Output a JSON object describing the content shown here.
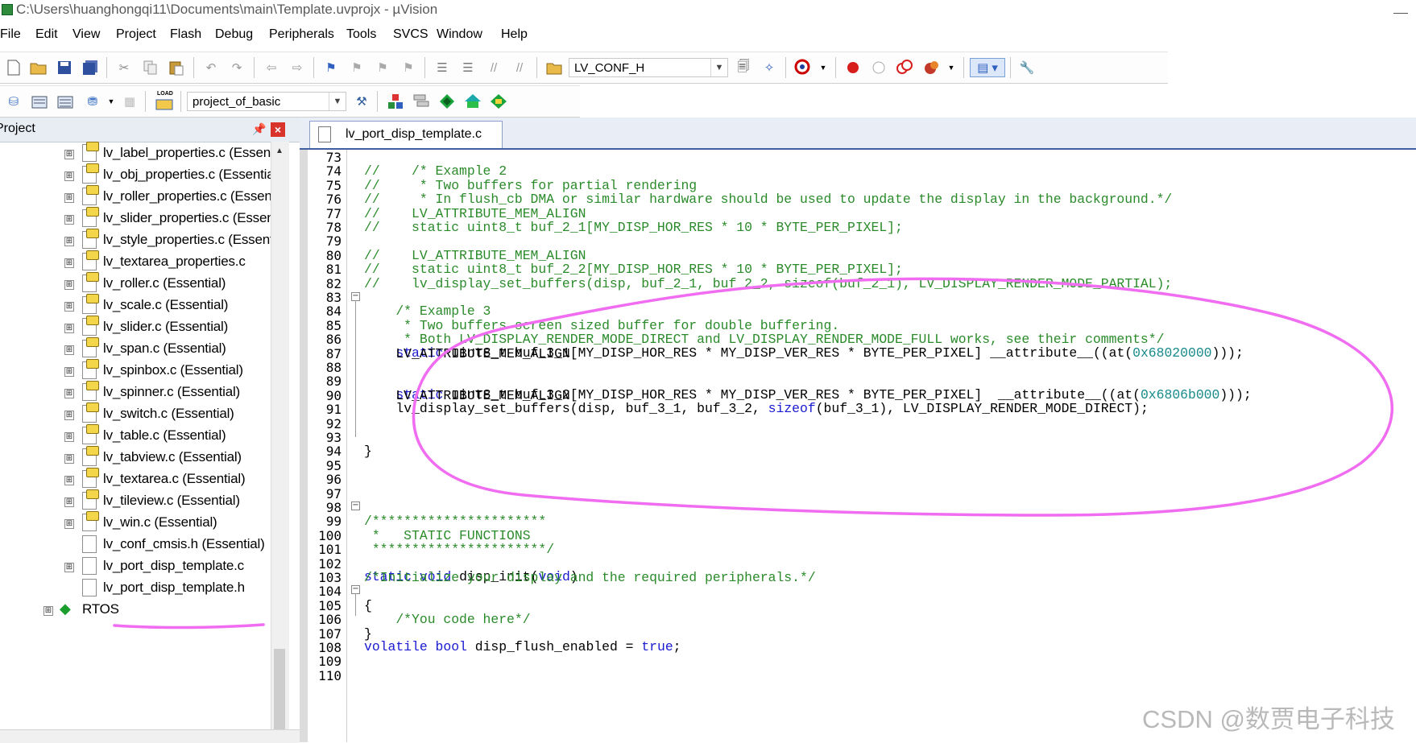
{
  "window": {
    "title": "C:\\Users\\huanghongqi11\\Documents\\main\\Template.uvprojx - µVision"
  },
  "menu": [
    "File",
    "Edit",
    "View",
    "Project",
    "Flash",
    "Debug",
    "Peripherals",
    "Tools",
    "SVCS",
    "Window",
    "Help"
  ],
  "toolbar": {
    "find_combo": "LV_CONF_H",
    "target_combo": "project_of_basic",
    "load_label": "LOAD",
    "icons": [
      "new-file-icon",
      "open-folder-icon",
      "save-icon",
      "save-all-icon",
      "cut-icon",
      "copy-icon",
      "paste-icon",
      "undo-icon",
      "redo-icon",
      "nav-back-icon",
      "nav-forward-icon",
      "bookmark-icon",
      "bookmark-prev-icon",
      "bookmark-next-icon",
      "bookmark-clear-icon",
      "indent-icon",
      "unindent-icon",
      "comment-icon",
      "uncomment-icon",
      "find-in-files-icon",
      "find-icon",
      "incremental-find-icon",
      "debug-session-icon",
      "breakpoint-icon",
      "breakpoint-disable-icon",
      "breakpoint-disable-all-icon",
      "breakpoint-kill-all-icon",
      "window-layout-icon",
      "configure-icon",
      "translate-icon",
      "build-icon",
      "rebuild-icon",
      "batch-build-icon",
      "stop-build-icon",
      "download-icon",
      "target-options-icon",
      "manage-components-icon",
      "select-packs-icon",
      "pack-installer-icon",
      "runtime-env-icon"
    ]
  },
  "project_panel": {
    "title": "Project",
    "pin": "📌",
    "close": "×",
    "items": [
      {
        "label": "lv_label_properties.c (Essential)",
        "expander": "⊞"
      },
      {
        "label": "lv_obj_properties.c (Essential)",
        "expander": "⊞"
      },
      {
        "label": "lv_roller_properties.c (Essential)",
        "expander": "⊞"
      },
      {
        "label": "lv_slider_properties.c (Essential)",
        "expander": "⊞"
      },
      {
        "label": "lv_style_properties.c (Essential)",
        "expander": "⊞"
      },
      {
        "label": "lv_textarea_properties.c",
        "expander": "⊞"
      },
      {
        "label": "lv_roller.c (Essential)",
        "expander": "⊞"
      },
      {
        "label": "lv_scale.c (Essential)",
        "expander": "⊞"
      },
      {
        "label": "lv_slider.c (Essential)",
        "expander": "⊞"
      },
      {
        "label": "lv_span.c (Essential)",
        "expander": "⊞"
      },
      {
        "label": "lv_spinbox.c (Essential)",
        "expander": "⊞"
      },
      {
        "label": "lv_spinner.c (Essential)",
        "expander": "⊞"
      },
      {
        "label": "lv_switch.c (Essential)",
        "expander": "⊞"
      },
      {
        "label": "lv_table.c (Essential)",
        "expander": "⊞"
      },
      {
        "label": "lv_tabview.c (Essential)",
        "expander": "⊞"
      },
      {
        "label": "lv_textarea.c (Essential)",
        "expander": "⊞"
      },
      {
        "label": "lv_tileview.c (Essential)",
        "expander": "⊞"
      },
      {
        "label": "lv_win.c (Essential)",
        "expander": "⊞"
      },
      {
        "label": "lv_conf_cmsis.h (Essential)",
        "expander": ""
      },
      {
        "label": "lv_port_disp_template.c",
        "expander": "⊞"
      },
      {
        "label": "lv_port_disp_template.h",
        "expander": ""
      }
    ],
    "rtos": {
      "label": "RTOS",
      "expander": "⊞"
    }
  },
  "editor": {
    "tab_label": "lv_port_disp_template.c",
    "lines": [
      {
        "n": "73",
        "t": "",
        "c": "p"
      },
      {
        "n": "74",
        "t": "//    /* Example 2",
        "c": "c"
      },
      {
        "n": "75",
        "t": "//     * Two buffers for partial rendering",
        "c": "c"
      },
      {
        "n": "76",
        "t": "//     * In flush_cb DMA or similar hardware should be used to update the display in the background.*/",
        "c": "c"
      },
      {
        "n": "77",
        "t": "//    LV_ATTRIBUTE_MEM_ALIGN",
        "c": "c"
      },
      {
        "n": "78",
        "t": "//    static uint8_t buf_2_1[MY_DISP_HOR_RES * 10 * BYTE_PER_PIXEL];",
        "c": "c"
      },
      {
        "n": "79",
        "t": "",
        "c": "p"
      },
      {
        "n": "80",
        "t": "//    LV_ATTRIBUTE_MEM_ALIGN",
        "c": "c"
      },
      {
        "n": "81",
        "t": "//    static uint8_t buf_2_2[MY_DISP_HOR_RES * 10 * BYTE_PER_PIXEL];",
        "c": "c"
      },
      {
        "n": "82",
        "t": "//    lv_display_set_buffers(disp, buf_2_1, buf_2_2, sizeof(buf_2_1), LV_DISPLAY_RENDER_MODE_PARTIAL);",
        "c": "c"
      },
      {
        "n": "83",
        "t": "",
        "c": "p"
      },
      {
        "n": "84",
        "t": "    /* Example 3",
        "c": "c"
      },
      {
        "n": "85",
        "t": "     * Two buffers screen sized buffer for double buffering.",
        "c": "c"
      },
      {
        "n": "86",
        "t": "     * Both LV_DISPLAY_RENDER_MODE_DIRECT and LV_DISPLAY_RENDER_MODE_FULL works, see their comments*/",
        "c": "c"
      },
      {
        "n": "87",
        "t": "    LV_ATTRIBUTE_MEM_ALIGN",
        "c": "p"
      },
      {
        "n": "88",
        "t": "",
        "c": "p"
      },
      {
        "n": "89",
        "t": "",
        "c": "p"
      },
      {
        "n": "90",
        "t": "    LV_ATTRIBUTE_MEM_ALIGN",
        "c": "p"
      },
      {
        "n": "91",
        "t": "",
        "c": "p"
      },
      {
        "n": "92",
        "t": "",
        "c": "p"
      },
      {
        "n": "93",
        "t": "",
        "c": "p"
      },
      {
        "n": "94",
        "t": "}",
        "c": "p"
      },
      {
        "n": "95",
        "t": "",
        "c": "p"
      },
      {
        "n": "96",
        "t": "",
        "c": "p"
      },
      {
        "n": "97",
        "t": "",
        "c": "p"
      },
      {
        "n": "98",
        "t": "",
        "c": "p"
      },
      {
        "n": "99",
        "t": "/**********************",
        "c": "c"
      },
      {
        "n": "100",
        "t": " *   STATIC FUNCTIONS",
        "c": "c"
      },
      {
        "n": "101",
        "t": " **********************/",
        "c": "c"
      },
      {
        "n": "102",
        "t": "",
        "c": "p"
      },
      {
        "n": "103",
        "t": "/*Initialize your display and the required peripherals.*/",
        "c": "c"
      },
      {
        "n": "104",
        "t": "",
        "c": "p"
      },
      {
        "n": "105",
        "t": "{",
        "c": "p"
      },
      {
        "n": "106",
        "t": "    /*You code here*/",
        "c": "c"
      },
      {
        "n": "107",
        "t": "}",
        "c": "p"
      },
      {
        "n": "108",
        "t": "",
        "c": "p"
      },
      {
        "n": "109",
        "t": "",
        "c": "p"
      },
      {
        "n": "110",
        "t": "",
        "c": "p"
      }
    ],
    "line88": {
      "kw": "static",
      "mid": " uint8_t buf_3_1[MY_DISP_HOR_RES * MY_DISP_VER_RES * BYTE_PER_PIXEL] __attribute__((at(",
      "num": "0x68020000",
      "end": ")));"
    },
    "line91": {
      "kw": "static",
      "mid": " uint8_t buf_3_2[MY_DISP_HOR_RES * MY_DISP_VER_RES * BYTE_PER_PIXEL]  __attribute__((at(",
      "num": "0x6806b000",
      "end": ")));"
    },
    "line92": {
      "a": "lv_display_set_buffers(disp, buf_3_1, buf_3_2, ",
      "kw": "sizeof",
      "b": "(buf_3_1), LV_DISPLAY_RENDER_MODE_DIRECT);"
    },
    "line104": {
      "kw1": "static",
      "kw2": "void",
      "mid": " disp_init(",
      "kw3": "void",
      "end": ")"
    },
    "line109": {
      "kw1": "volatile",
      "kw2": "bool",
      "mid": " disp_flush_enabled = ",
      "kw3": "true",
      "end": ";"
    }
  },
  "watermark": "CSDN @数贾电子科技",
  "colors": {
    "annotation": "#f06cf0",
    "comment": "#2b8b2b",
    "keyword": "#1a1ad0",
    "number": "#188a8a"
  }
}
